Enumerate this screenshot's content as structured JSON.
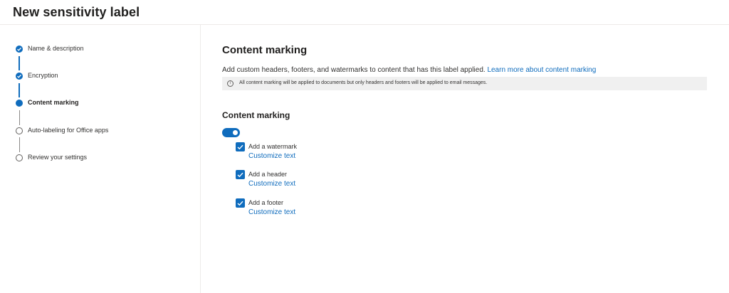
{
  "page": {
    "title": "New sensitivity label"
  },
  "steps": [
    {
      "label": "Name & description",
      "state": "done"
    },
    {
      "label": "Encryption",
      "state": "done"
    },
    {
      "label": "Content marking",
      "state": "current"
    },
    {
      "label": "Auto-labeling for Office apps",
      "state": "todo"
    },
    {
      "label": "Review your settings",
      "state": "todo"
    }
  ],
  "main": {
    "title": "Content marking",
    "description": "Add custom headers, footers, and watermarks to content that has this label applied.",
    "learn_more": "Learn more about content marking",
    "notice": "All content marking will be applied to documents but only headers and footers will be applied to email messages.",
    "sub_title": "Content marking",
    "toggle_on": true,
    "options": [
      {
        "label": "Add a watermark",
        "checked": true,
        "link": "Customize text"
      },
      {
        "label": "Add a header",
        "checked": true,
        "link": "Customize text"
      },
      {
        "label": "Add a footer",
        "checked": true,
        "link": "Customize text"
      }
    ]
  },
  "colors": {
    "accent": "#0f6cbd",
    "notice_bg": "#f0f0f0"
  }
}
